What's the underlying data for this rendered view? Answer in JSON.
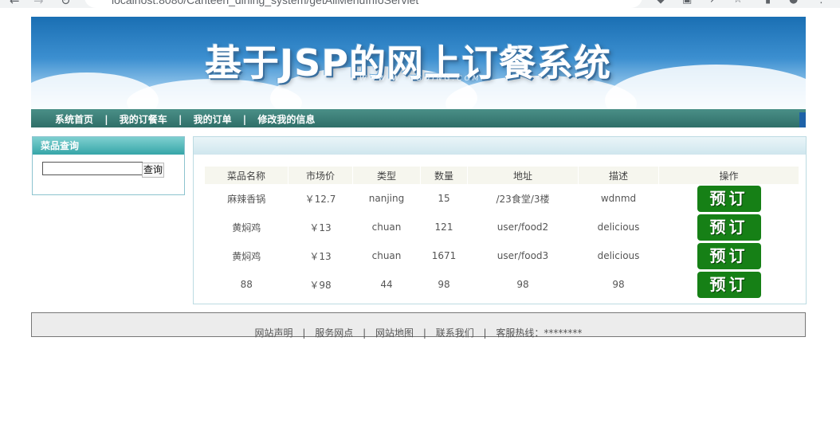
{
  "browser": {
    "url": "localhost:8080/Canteen_dining_system/getAllMenuInfoServlet"
  },
  "banner": {
    "title": "基于JSP的网上订餐系统",
    "subtitle": "WWW.WANGDING.COM"
  },
  "nav": {
    "items": [
      {
        "label": "系统首页"
      },
      {
        "label": "我的订餐车"
      },
      {
        "label": "我的订单"
      },
      {
        "label": "修改我的信息"
      }
    ],
    "separator": "|"
  },
  "sidebar": {
    "title": "菜品查询",
    "search_value": "",
    "search_button": "查询"
  },
  "menu_table": {
    "headers": [
      "菜品名称",
      "市场价",
      "类型",
      "数量",
      "地址",
      "描述",
      "操作"
    ],
    "rows": [
      {
        "name": "麻辣香锅",
        "price": "￥12.7",
        "type": "nanjing",
        "qty": "15",
        "address": "/23食堂/3楼",
        "desc": "wdnmd",
        "action": "预订"
      },
      {
        "name": "黄焖鸡",
        "price": "￥13",
        "type": "chuan",
        "qty": "121",
        "address": "user/food2",
        "desc": "delicious",
        "action": "预订"
      },
      {
        "name": "黄焖鸡",
        "price": "￥13",
        "type": "chuan",
        "qty": "1671",
        "address": "user/food3",
        "desc": "delicious",
        "action": "预订"
      },
      {
        "name": "88",
        "price": "￥98",
        "type": "44",
        "qty": "98",
        "address": "98",
        "desc": "98",
        "action": "预订"
      }
    ]
  },
  "footer": {
    "links": [
      {
        "label": "网站声明"
      },
      {
        "label": "服务网点"
      },
      {
        "label": "网站地图"
      },
      {
        "label": "联系我们"
      },
      {
        "label": "客服热线：********"
      }
    ]
  }
}
